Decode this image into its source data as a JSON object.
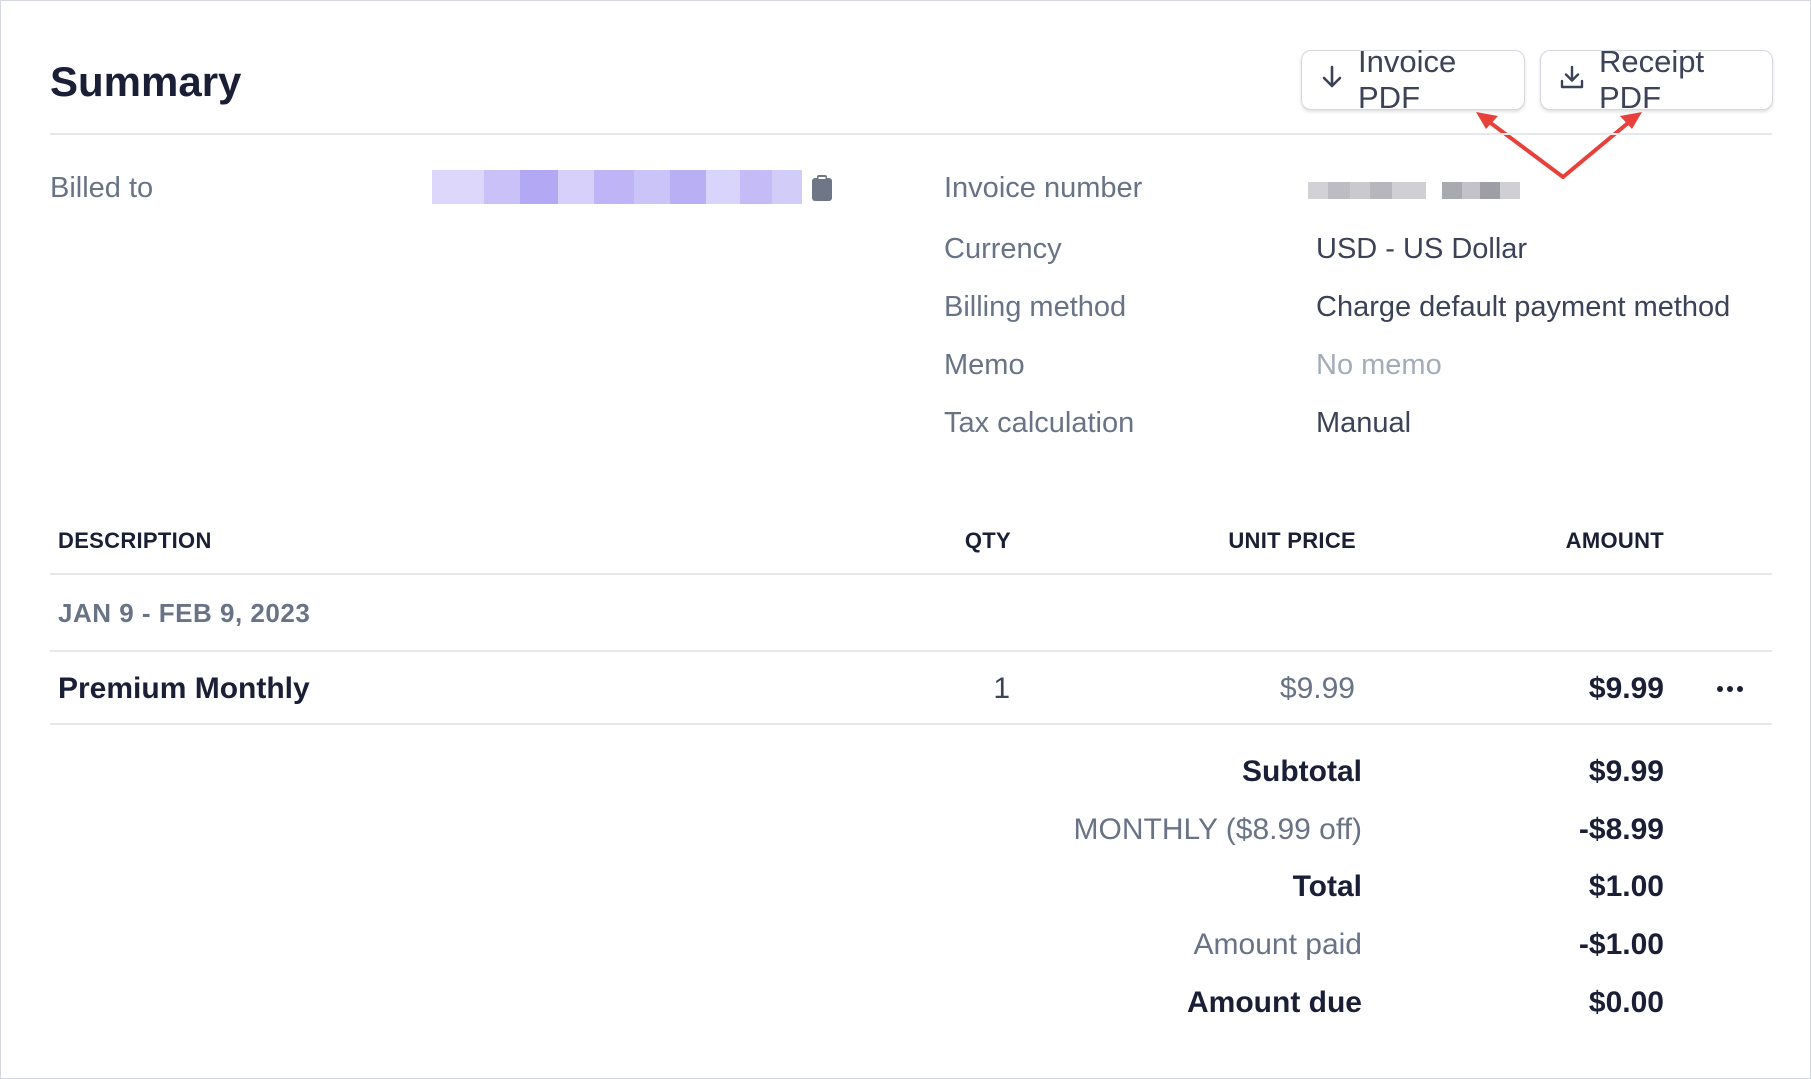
{
  "header": {
    "title": "Summary",
    "invoice_pdf_label": "Invoice PDF",
    "receipt_pdf_label": "Receipt PDF"
  },
  "details": {
    "billed_to_label": "Billed to",
    "invoice_number_label": "Invoice number",
    "currency_label": "Currency",
    "currency_value": "USD - US Dollar",
    "billing_method_label": "Billing method",
    "billing_method_value": "Charge default payment method",
    "memo_label": "Memo",
    "memo_value": "No memo",
    "tax_label": "Tax calculation",
    "tax_value": "Manual"
  },
  "table": {
    "columns": [
      "DESCRIPTION",
      "QTY",
      "UNIT PRICE",
      "AMOUNT"
    ],
    "period": "JAN 9 - FEB 9, 2023",
    "rows": [
      {
        "description": "Premium Monthly",
        "qty": "1",
        "unit_price": "$9.99",
        "amount": "$9.99"
      }
    ]
  },
  "totals": [
    {
      "label": "Subtotal",
      "value": "$9.99"
    },
    {
      "label": "MONTHLY ($8.99 off)",
      "value": "-$8.99"
    },
    {
      "label": "Total",
      "value": "$1.00"
    },
    {
      "label": "Amount paid",
      "value": "-$1.00"
    },
    {
      "label": "Amount due",
      "value": "$0.00"
    }
  ],
  "icons": {
    "invoice_button": "arrow-down-icon",
    "receipt_button": "download-icon",
    "copy": "clipboard-icon",
    "row_menu": "more-horizontal-icon"
  },
  "colors": {
    "annotation_arrow": "#e8403a",
    "redaction_billed_to": "#bcb3f7",
    "redaction_invoice_number": "#b9b9bf"
  }
}
